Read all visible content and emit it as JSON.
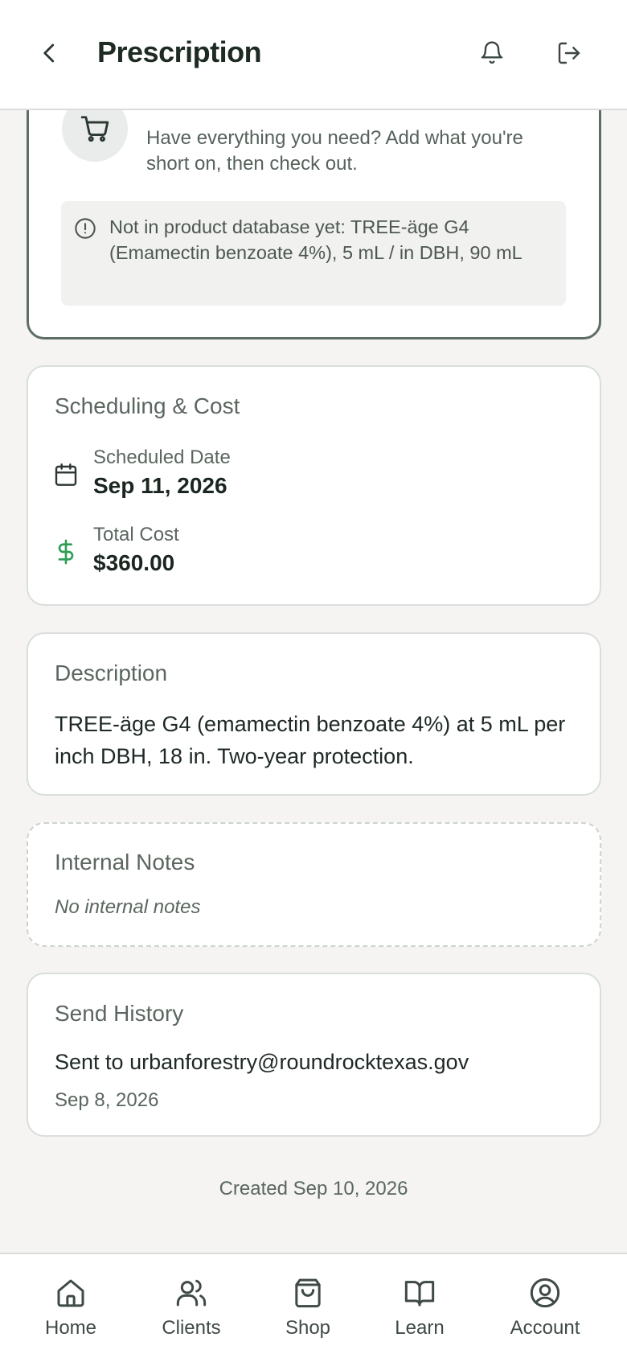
{
  "header": {
    "title": "Prescription"
  },
  "cart_card": {
    "description": "Have everything you need? Add what you're short on, then check out.",
    "warning": "Not in product database yet: TREE-äge G4 (Emamectin benzoate 4%), 5 mL / in DBH, 90 mL"
  },
  "scheduling": {
    "title": "Scheduling & Cost",
    "date_label": "Scheduled Date",
    "date_value": "Sep 11, 2026",
    "cost_label": "Total Cost",
    "cost_value": "$360.00"
  },
  "description": {
    "title": "Description",
    "text": "TREE-äge G4 (emamectin benzoate 4%) at 5 mL per inch DBH, 18 in. Two-year protection."
  },
  "internal_notes": {
    "title": "Internal Notes",
    "empty_text": "No internal notes"
  },
  "send_history": {
    "title": "Send History",
    "sent_prefix": "Sent to ",
    "email": "urbanforestry@roundrocktexas.gov",
    "date": "Sep 8, 2026"
  },
  "created": "Created Sep 10, 2026",
  "nav": {
    "items": [
      {
        "label": "Home",
        "icon": "home-icon"
      },
      {
        "label": "Clients",
        "icon": "users-icon"
      },
      {
        "label": "Shop",
        "icon": "shopping-bag-icon"
      },
      {
        "label": "Learn",
        "icon": "book-open-icon"
      },
      {
        "label": "Account",
        "icon": "user-circle-icon"
      }
    ]
  },
  "colors": {
    "accent_green": "#2f9e55",
    "card_border_dark": "#5f6e64",
    "background": "#f5f4f2"
  }
}
